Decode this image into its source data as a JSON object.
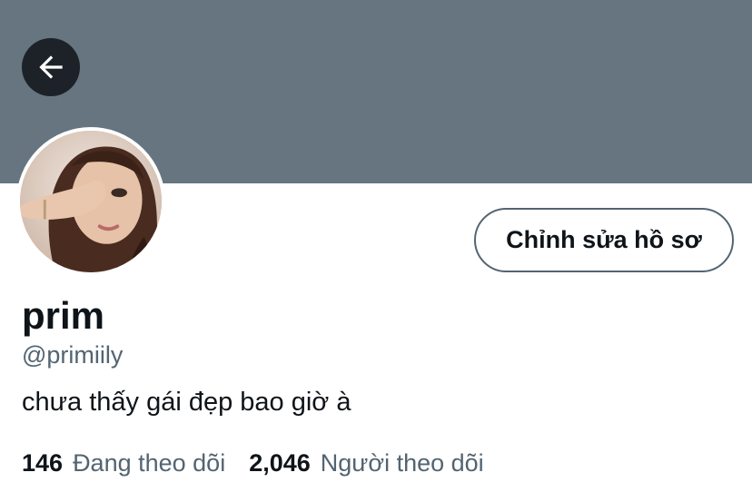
{
  "header": {
    "banner_color": "#66757f",
    "back_icon": "arrow-left-icon"
  },
  "profile": {
    "avatar": "profile-photo",
    "edit_button_label": "Chỉnh sửa hồ sơ",
    "display_name": "prim",
    "handle": "@primiily",
    "bio": "chưa thấy gái đẹp bao giờ à",
    "following_count": "146",
    "following_label": "Đang theo dõi",
    "followers_count": "2,046",
    "followers_label": "Người theo dõi"
  }
}
